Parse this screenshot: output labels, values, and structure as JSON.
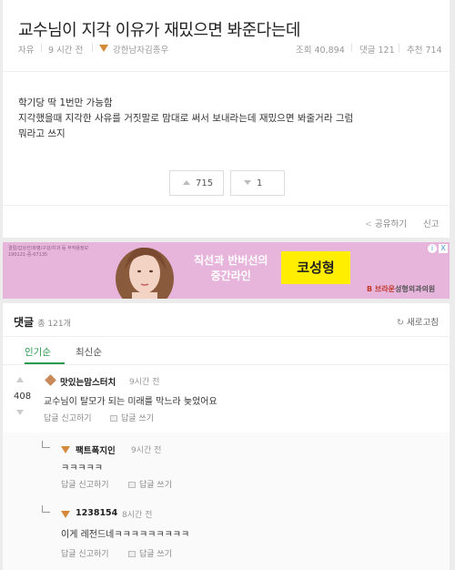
{
  "post": {
    "title": "교수님이 지각 이유가 재밌으면 봐준다는데",
    "board": "자유",
    "time_ago": "9 시간 전",
    "author": "강한남자김종우",
    "views": "조회 40,894",
    "comments": "댓글 121",
    "recommends": "추천 714",
    "body_lines": [
      "학기당 딱 1번만 가능함",
      "지각했을때 지각한 사유를 거짓말로 맘대로 써서 보내라는데 재밌으면 봐줄거라 그럼",
      "뭐라고 쓰지"
    ],
    "upvotes": "715",
    "downvotes": "1",
    "share_label": "공유하기",
    "report_label": "신고"
  },
  "ad": {
    "small_lines": [
      "결절/갑상선/화병/구강/치과 등 부작용정보",
      "190121-중-07135"
    ],
    "headline_1": "직선과 반버선의",
    "headline_2": "중간라인",
    "brand": "코성형",
    "clinic_mark": "B",
    "clinic": "브라운",
    "clinic_suffix": "성형외과의원",
    "info_icon": "i",
    "close_icon": "X"
  },
  "comments_section": {
    "title": "댓글",
    "count": "총 121개",
    "refresh_label": "새로고침",
    "tabs": [
      "인기순",
      "최신순"
    ],
    "items": [
      {
        "score": "408",
        "nick": "맛있는맘스터치",
        "time": "9시간 전",
        "text": "교수님이 탈모가 되는 미래를 막느라 늦었어요",
        "reply_label": "답글 신고하기",
        "write_label": "답글 쓰기"
      },
      {
        "nick": "팩트폭지인",
        "time": "9시간 전",
        "text": "ㅋㅋㅋㅋㅋ",
        "reply_label": "답글 신고하기",
        "write_label": "답글 쓰기"
      },
      {
        "nick": "1238154",
        "time": "8시간 전",
        "text": "이게 레전드네ㅋㅋㅋㅋㅋㅋㅋㅋㅋ",
        "reply_label": "답글 신고하기",
        "write_label": "답글 쓰기"
      }
    ]
  },
  "colors": {
    "accent_green": "#2b9b4f",
    "ad_bg": "#e7b4dc",
    "ad_brand_bg": "#ffee00",
    "rank_icon": "#d48a3a"
  }
}
